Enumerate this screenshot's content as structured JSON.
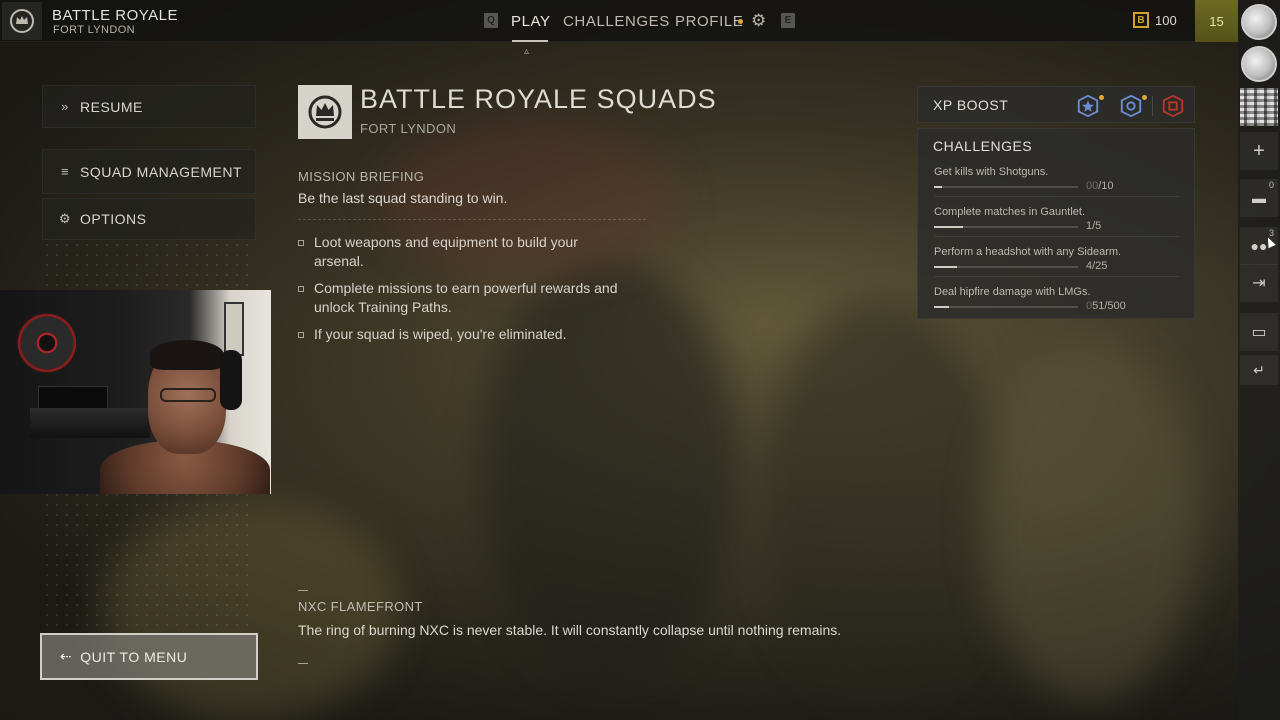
{
  "header": {
    "mode_title": "BATTLE ROYALE",
    "mode_subtitle": "FORT LYNDON",
    "key_left": "Q",
    "key_right": "E",
    "tabs": [
      {
        "label": "PLAY",
        "active": true
      },
      {
        "label": "CHALLENGES",
        "active": false
      },
      {
        "label": "PROFILE",
        "active": false,
        "has_notification": true
      }
    ],
    "currency_symbol": "B",
    "currency_value": "100",
    "player_level": "15",
    "icons": {
      "gear": "gear-icon",
      "logo": "crown-emblem-icon"
    }
  },
  "left_menu": {
    "items": [
      {
        "label": "RESUME",
        "icon": "chevrons-right-icon"
      },
      {
        "label": "SQUAD MANAGEMENT",
        "icon": "list-icon"
      },
      {
        "label": "OPTIONS",
        "icon": "gear-icon"
      }
    ],
    "quit_label": "QUIT TO MENU",
    "quit_icon": "exit-icon"
  },
  "mode": {
    "title": "BATTLE ROYALE SQUADS",
    "subtitle": "FORT LYNDON",
    "briefing_heading": "MISSION BRIEFING",
    "briefing_text": "Be the last squad standing to win.",
    "bullets": [
      "Loot weapons and equipment to build your arsenal.",
      "Complete missions to earn powerful rewards and unlock Training Paths.",
      "If your squad is wiped, you're eliminated."
    ],
    "feature_heading": "NXC FLAMEFRONT",
    "feature_text": "The ring of burning NXC is never stable. It will constantly collapse until nothing remains."
  },
  "xp_boost": {
    "label": "XP BOOST",
    "icons": [
      "star-badge-icon",
      "weapon-badge-icon",
      "battle-pass-badge-icon"
    ]
  },
  "challenges": {
    "title": "CHALLENGES",
    "items": [
      {
        "text": "Get kills with Shotguns.",
        "progress_dim": "00",
        "progress_rest": "/10",
        "fraction": 0.0
      },
      {
        "text": "Complete matches in Gauntlet.",
        "progress_dim": "",
        "progress_rest": "1/5",
        "fraction": 0.2
      },
      {
        "text": "Perform a headshot with any Sidearm.",
        "progress_dim": "",
        "progress_rest": "4/25",
        "fraction": 0.16
      },
      {
        "text": "Deal hipfire damage with LMGs.",
        "progress_dim": "0",
        "progress_rest": "51/500",
        "fraction": 0.102
      }
    ]
  },
  "social": {
    "friends_count": "0",
    "party_count": "3",
    "icons": [
      "avatar-icon",
      "avatar-icon",
      "qr-code-icon",
      "plus-icon",
      "mail-icon",
      "party-icon",
      "arrow-right-icon",
      "chat-icon",
      "return-icon"
    ]
  },
  "colors": {
    "accent_gold": "#d2a52a",
    "notification_orange": "#e0a83a",
    "level_badge": "#6d6a23",
    "battle_pass_red": "#c0392b"
  }
}
